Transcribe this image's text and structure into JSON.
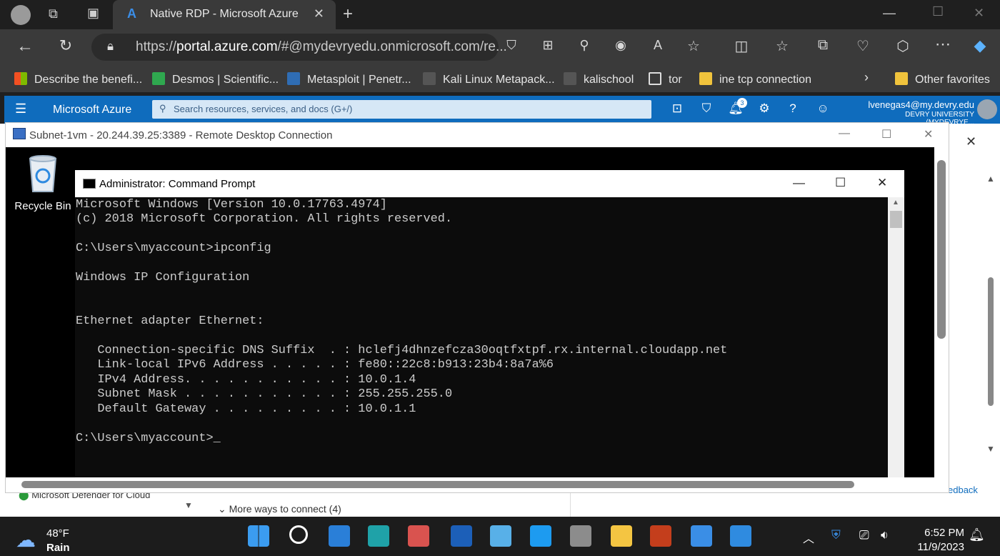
{
  "browser": {
    "tab_title": "Native RDP - Microsoft Azure",
    "address": {
      "prefix": "https://",
      "host": "portal.azure.com",
      "path": "/#@mydevryedu.onmicrosoft.com/re..."
    },
    "favorites": [
      {
        "label": "Describe the benefi...",
        "color": "#f25022"
      },
      {
        "label": "Desmos | Scientific...",
        "color": "#2fa84f"
      },
      {
        "label": "Metasploit | Penetr...",
        "color": "#2f6db4"
      },
      {
        "label": "Kali Linux Metapack...",
        "color": "#cccccc"
      },
      {
        "label": "kalischool",
        "color": "#cccccc"
      },
      {
        "label": "tor",
        "color": "#cccccc"
      },
      {
        "label": "ine tcp connection",
        "color": "#f0c33c"
      }
    ],
    "other_favorites": "Other favorites"
  },
  "azure": {
    "brand": "Microsoft Azure",
    "search_placeholder": "Search resources, services, and docs (G+/)",
    "notification_count": "3",
    "user_email": "lvenegas4@my.devry.edu",
    "user_org": "DEVRY UNIVERSITY (MYDEVRYE...",
    "background": {
      "defender": "Microsoft Defender for Cloud",
      "more_ways": "More ways to connect (4)",
      "feedback_fragment": "edback"
    }
  },
  "rdp": {
    "title": "Subnet-1vm - 20.244.39.25:3389 - Remote Desktop Connection",
    "recycle_bin": "Recycle Bin"
  },
  "cmd": {
    "title": "Administrator: Command Prompt",
    "lines": [
      "Microsoft Windows [Version 10.0.17763.4974]",
      "(c) 2018 Microsoft Corporation. All rights reserved.",
      "",
      "C:\\Users\\myaccount>ipconfig",
      "",
      "Windows IP Configuration",
      "",
      "",
      "Ethernet adapter Ethernet:",
      "",
      "   Connection-specific DNS Suffix  . : hclefj4dhnzefcza30oqtfxtpf.rx.internal.cloudapp.net",
      "   Link-local IPv6 Address . . . . . : fe80::22c8:b913:23b4:8a7a%6",
      "   IPv4 Address. . . . . . . . . . . : 10.0.1.4",
      "   Subnet Mask . . . . . . . . . . . : 255.255.255.0",
      "   Default Gateway . . . . . . . . . : 10.0.1.1",
      "",
      "C:\\Users\\myaccount>_"
    ]
  },
  "taskbar": {
    "temperature": "48°F",
    "condition": "Rain",
    "time": "6:52 PM",
    "date": "11/9/2023",
    "apps": [
      {
        "icon": "start-icon",
        "color": "#3b9cf0"
      },
      {
        "icon": "search-icon",
        "color": "#ffffff"
      },
      {
        "icon": "mail-icon",
        "color": "#2a7fd8"
      },
      {
        "icon": "edge-icon",
        "color": "#1fa2a8"
      },
      {
        "icon": "snipping-tool-icon",
        "color": "#d9534f"
      },
      {
        "icon": "lockdown-browser-icon",
        "color": "#1c5fb8"
      },
      {
        "icon": "notepad-icon",
        "color": "#58b0e8"
      },
      {
        "icon": "twitter-icon",
        "color": "#1d9bf0"
      },
      {
        "icon": "calculator-icon",
        "color": "#8c8c8c"
      },
      {
        "icon": "file-explorer-icon",
        "color": "#f4c542"
      },
      {
        "icon": "powerpoint-icon",
        "color": "#c43e1c"
      },
      {
        "icon": "rdp-icon",
        "color": "#3a8ee6"
      },
      {
        "icon": "paint-icon",
        "color": "#2f8be0"
      }
    ]
  }
}
